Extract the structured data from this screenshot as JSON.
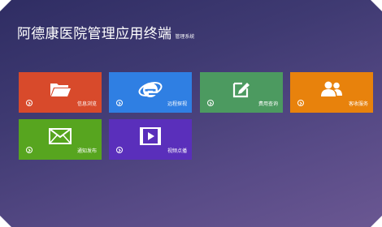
{
  "header": {
    "title": "阿德康医院管理应用终端",
    "subtitle": "管理系统"
  },
  "tiles": [
    {
      "label": "信息浏览",
      "icon": "folder-icon",
      "color": "#d84a2b"
    },
    {
      "label": "远程探视",
      "icon": "browser-icon",
      "color": "#2f7fe3"
    },
    {
      "label": "费用查询",
      "icon": "edit-icon",
      "color": "#4c9a60"
    },
    {
      "label": "客收服务",
      "icon": "users-icon",
      "color": "#e8820c"
    },
    {
      "label": "通知发布",
      "icon": "mail-icon",
      "color": "#57a51f"
    },
    {
      "label": "视频点播",
      "icon": "video-icon",
      "color": "#5a2fbb"
    }
  ]
}
